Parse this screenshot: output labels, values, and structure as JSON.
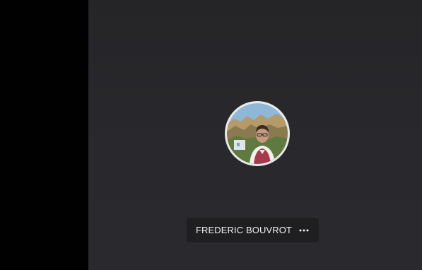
{
  "participant": {
    "name": "FREDERIC BOUVROT"
  },
  "icons": {
    "avatar": "participant-photo-avatar",
    "more": "more-options-icon"
  },
  "colors": {
    "tile_background": "#29292d",
    "pill_background": "#1f1f22",
    "avatar_ring": "#e9e9e9",
    "text": "#f2f2f2"
  }
}
